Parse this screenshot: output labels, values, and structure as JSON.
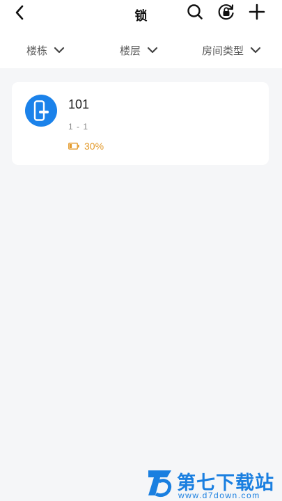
{
  "header": {
    "title": "锁",
    "icons": [
      "back-icon",
      "search-icon",
      "lock-refresh-icon",
      "plus-icon"
    ]
  },
  "filters": [
    {
      "label": "楼栋"
    },
    {
      "label": "楼层"
    },
    {
      "label": "房间类型"
    }
  ],
  "locks": [
    {
      "room": "101",
      "subtitle": "1 - 1",
      "battery": "30%",
      "battery_level": 0.3
    }
  ],
  "watermark": {
    "title": "第七下载站",
    "url": "www.d7down.com"
  },
  "colors": {
    "accent": "#1b82ea",
    "battery": "#e39a2b",
    "background": "#f5f6f8"
  }
}
